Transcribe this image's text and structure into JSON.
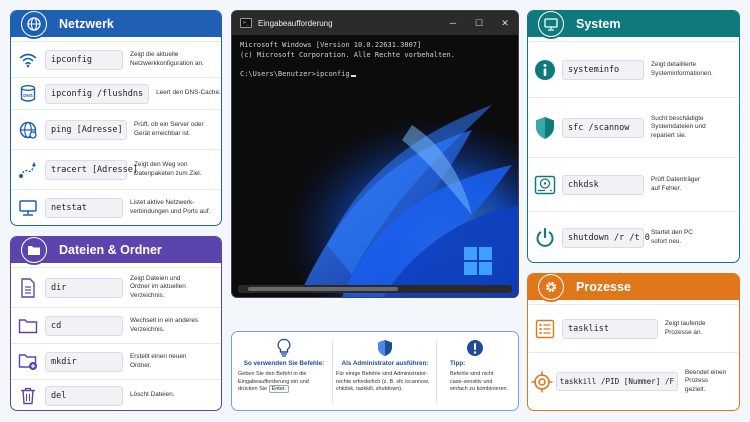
{
  "colors": {
    "network": "#1f5fb4",
    "files": "#5c44ad",
    "system": "#0e7a7e",
    "processes": "#e0761a"
  },
  "network": {
    "title": "Netzwerk",
    "items": [
      {
        "icon": "wifi-icon",
        "cmd": "ipconfig",
        "desc": [
          "Zeigt die aktuelle",
          "Netzwerkkonfiguration an."
        ]
      },
      {
        "icon": "dns-icon",
        "cmd": "ipconfig /flushdns",
        "desc": [
          "Leert den DNS-Cache."
        ]
      },
      {
        "icon": "globe-icon",
        "cmd": "ping [Adresse]",
        "desc": [
          "Prüft, ob ein Server oder",
          "Gerät erreichbar ist."
        ]
      },
      {
        "icon": "route-icon",
        "cmd": "tracert [Adresse]",
        "desc": [
          "Zeigt den Weg von",
          "Datenpaketen zum Ziel."
        ]
      },
      {
        "icon": "monitor-icon",
        "cmd": "netstat",
        "desc": [
          "Listet aktive Netzwerk-",
          "verbindungen und Ports auf."
        ]
      }
    ]
  },
  "files": {
    "title": "Dateien & Ordner",
    "items": [
      {
        "icon": "file-icon",
        "cmd": "dir",
        "desc": [
          "Zeigt Dateien und",
          "Ordner im aktuellen",
          "Verzeichnis."
        ]
      },
      {
        "icon": "folder-icon",
        "cmd": "cd",
        "desc": [
          "Wechselt in ein anderes",
          "Verzeichnis."
        ]
      },
      {
        "icon": "new-folder-icon",
        "cmd": "mkdir",
        "desc": [
          "Erstellt einen neuen",
          "Ordner."
        ]
      },
      {
        "icon": "trash-icon",
        "cmd": "del",
        "desc": [
          "Löscht Dateien."
        ]
      }
    ]
  },
  "system": {
    "title": "System",
    "items": [
      {
        "icon": "info-icon",
        "cmd": "systeminfo",
        "desc": [
          "Zeigt detaillierte",
          "Systeminformationen."
        ]
      },
      {
        "icon": "shield-icon",
        "cmd": "sfc /scannow",
        "desc": [
          "Sucht beschädigte",
          "Systemdateien und",
          "repariert sie."
        ]
      },
      {
        "icon": "disk-icon",
        "cmd": "chkdsk",
        "desc": [
          "Prüft Datenträger",
          "auf Fehler."
        ]
      },
      {
        "icon": "power-icon",
        "cmd": "shutdown /r /t 0",
        "desc": [
          "Startet den PC",
          "sofort neu."
        ]
      }
    ]
  },
  "processes": {
    "title": "Prozesse",
    "items": [
      {
        "icon": "list-icon",
        "cmd": "tasklist",
        "desc": [
          "Zeigt laufende",
          "Prozesse an."
        ]
      },
      {
        "icon": "target-icon",
        "cmd": "taskkill /PID [Nummer] /F",
        "desc": [
          "Beendet einen Prozess",
          "gezielt."
        ]
      }
    ]
  },
  "terminal": {
    "title": "Eingabeaufforderung",
    "lines": [
      "Microsoft Windows [Version 10.0.22631.3007]",
      "(c) Microsoft Corporation. Alle Rechte vorbehalten.",
      "",
      "C:\\Users\\Benutzer>ipconfig"
    ]
  },
  "tips": [
    {
      "icon": "lightbulb-icon",
      "title": "So verwenden Sie Befehle:",
      "lines": [
        "Geben Sie den Befehl in die",
        "Eingabeaufforderung ein und",
        "drücken Sie"
      ],
      "key": "Enter."
    },
    {
      "icon": "admin-shield-icon",
      "title": "Als Administrator ausführen:",
      "lines": [
        "Für einige Befehle sind Administrator-",
        "rechte erforderlich (z. B. sfc /scannow,",
        "chkdsk, taskkill, shutdown)."
      ]
    },
    {
      "icon": "alert-icon",
      "title": "Tipp:",
      "lines": [
        "Befehle sind nicht",
        "case-sensitiv und",
        "einfach zu kombinieren."
      ]
    }
  ]
}
